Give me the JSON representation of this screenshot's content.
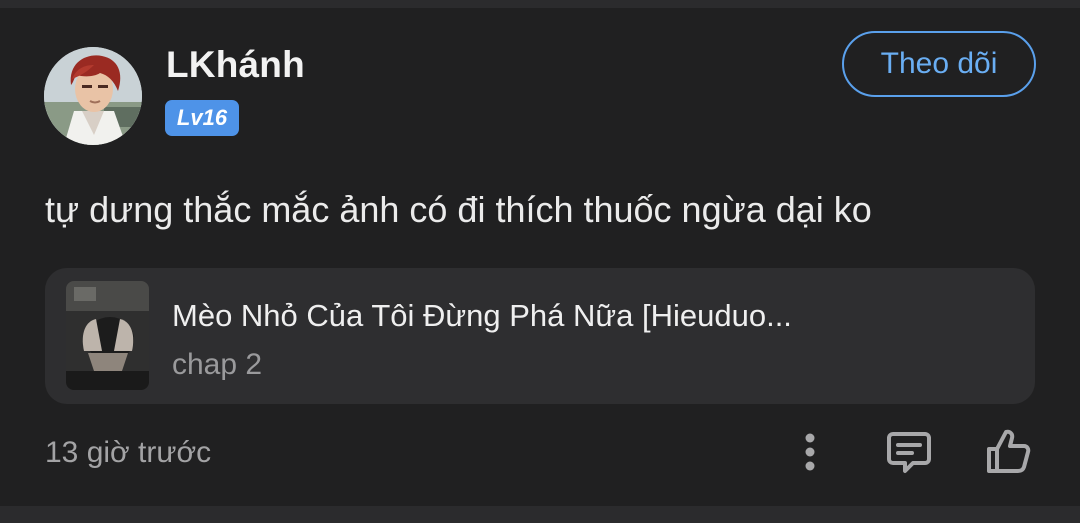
{
  "comment": {
    "user": {
      "name": "LKhánh",
      "level": "Lv16"
    },
    "follow_label": "Theo dõi",
    "text": "tự dưng thắc mắc ảnh có đi thích thuốc ngừa dại ko",
    "manga": {
      "title": "Mèo Nhỏ Của Tôi Đừng Phá Nữa [Hieuduo...",
      "chapter": "chap 2"
    },
    "timestamp": "13 giờ trước",
    "actions": {
      "more_icon": "more-vertical-icon",
      "reply_icon": "comment-reply-icon",
      "like_icon": "thumbs-up-icon"
    }
  },
  "colors": {
    "background": "#202021",
    "card": "#2e2e30",
    "accent": "#5aa0ec",
    "badge": "#4e93e8",
    "secondary_text": "#a3a3a5"
  }
}
